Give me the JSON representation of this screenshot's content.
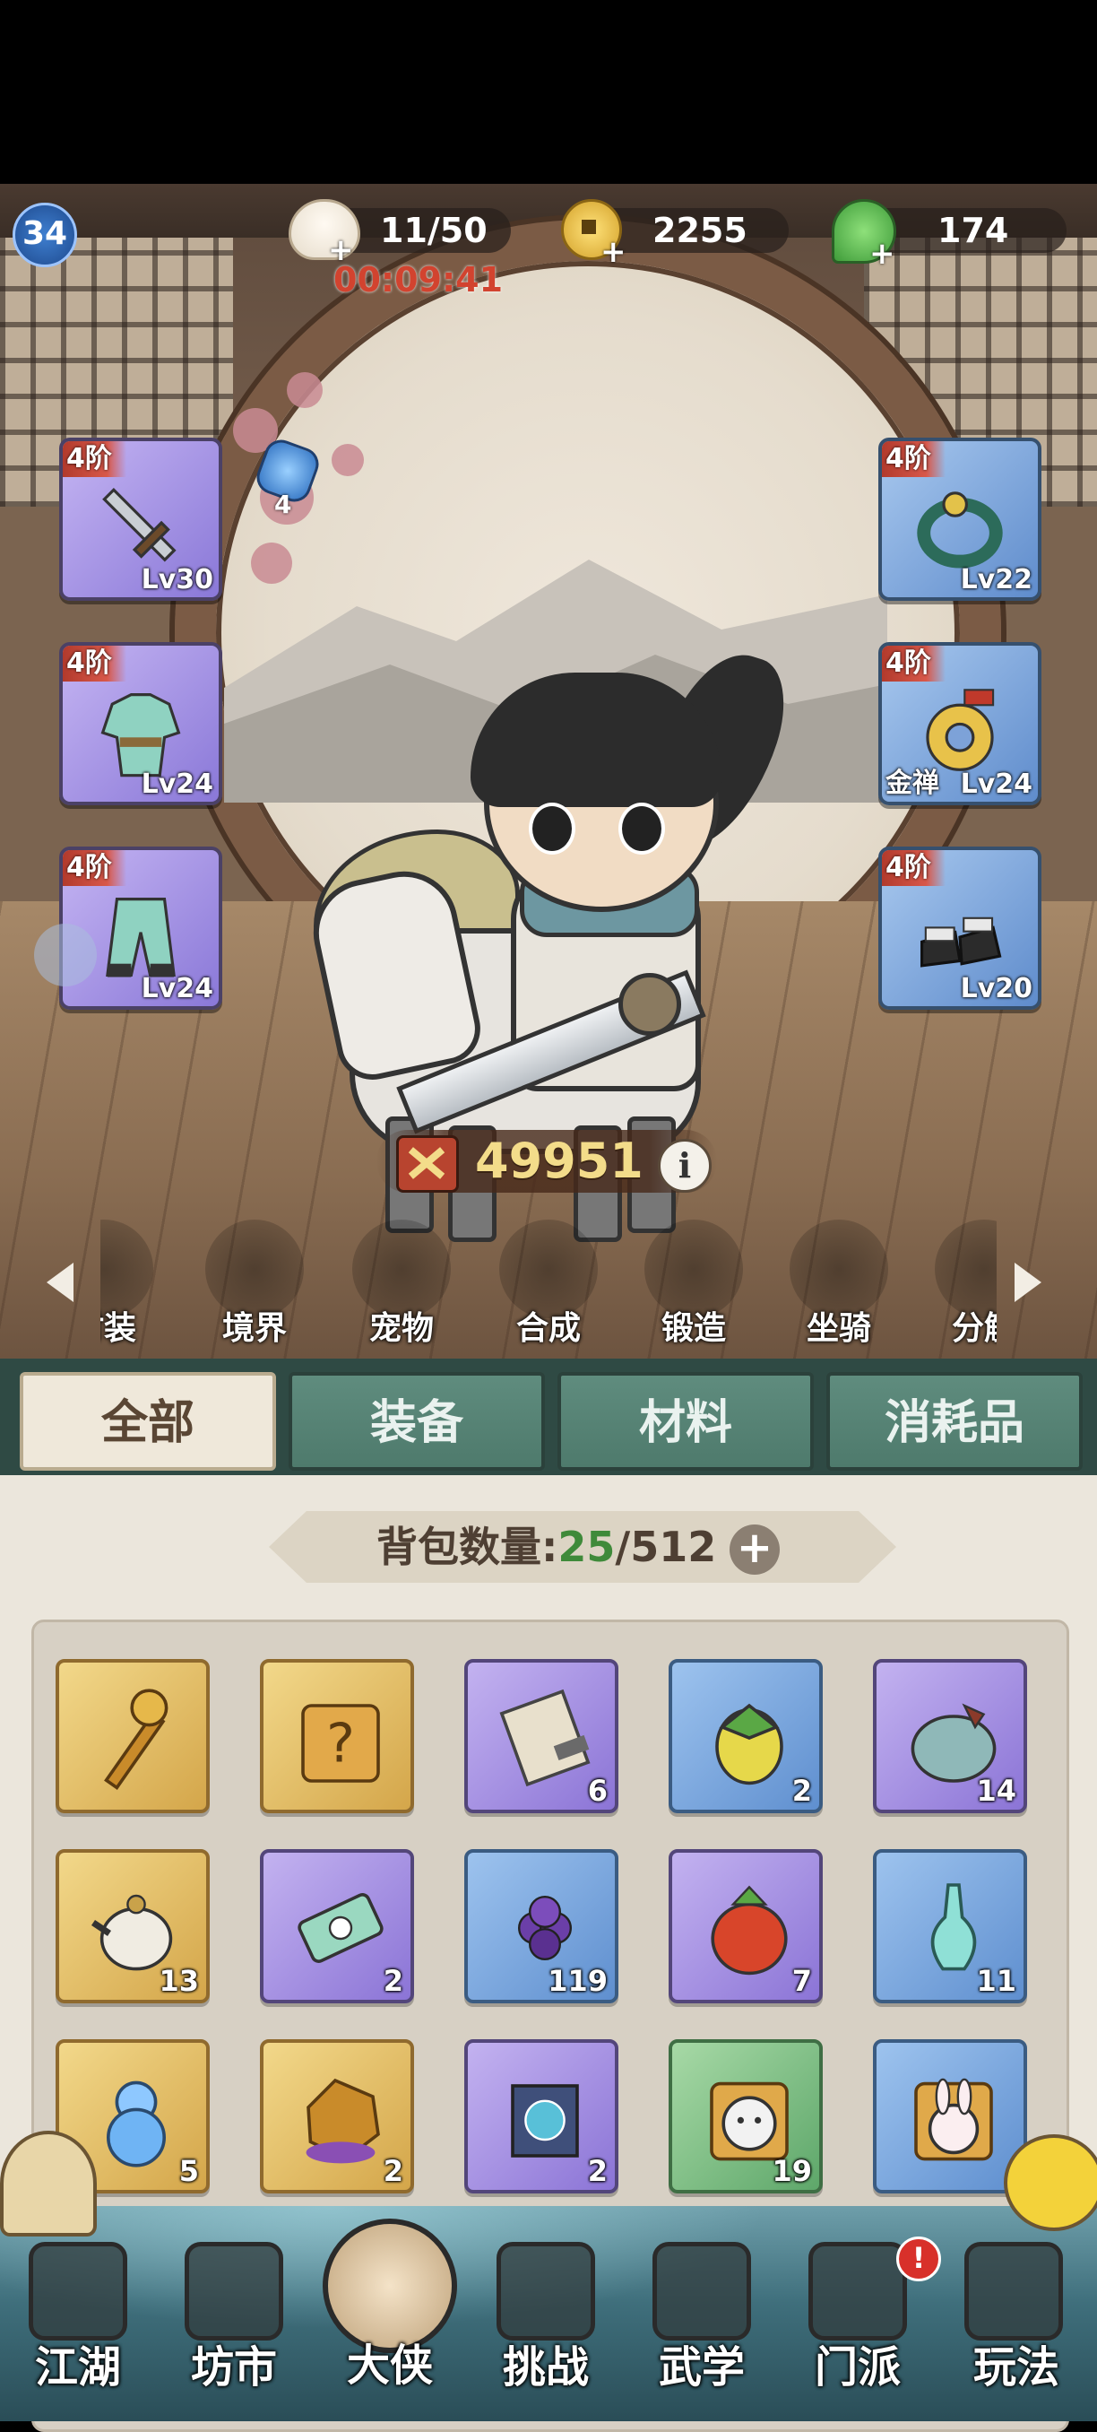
{
  "status": {
    "level": "34",
    "stamina": "11/50",
    "stamina_timer": "00:09:41",
    "coins": "2255",
    "leaves": "174"
  },
  "equipment": {
    "left": [
      {
        "tier": "4阶",
        "level": "Lv30",
        "icon": "sword-icon"
      },
      {
        "tier": "4阶",
        "level": "Lv24",
        "icon": "robe-icon"
      },
      {
        "tier": "4阶",
        "level": "Lv24",
        "icon": "pants-icon"
      }
    ],
    "right": [
      {
        "tier": "4阶",
        "level": "Lv22",
        "icon": "bracelet-icon"
      },
      {
        "tier": "4阶",
        "name": "金禅",
        "level": "Lv24",
        "icon": "jade-ring-icon"
      },
      {
        "tier": "4阶",
        "level": "Lv20",
        "icon": "boots-icon"
      }
    ],
    "gem_count": "4"
  },
  "combat_power": "49951",
  "functions": [
    {
      "label": "时装",
      "icon": "costume-icon"
    },
    {
      "label": "境界",
      "icon": "realm-icon"
    },
    {
      "label": "宠物",
      "icon": "pet-icon"
    },
    {
      "label": "合成",
      "icon": "synthesis-icon"
    },
    {
      "label": "锻造",
      "icon": "forge-icon"
    },
    {
      "label": "坐骑",
      "icon": "mount-icon"
    },
    {
      "label": "分解",
      "icon": "decompose-icon"
    }
  ],
  "bag": {
    "tabs": [
      "全部",
      "装备",
      "材料",
      "消耗品"
    ],
    "active_tab": 0,
    "count_label": "背包数量:",
    "count_used": "25",
    "count_total": "/512",
    "items": [
      {
        "quality": "gold",
        "count": "",
        "icon": "golden-staff-icon"
      },
      {
        "quality": "gold",
        "count": "",
        "icon": "mystery-puzzle-icon"
      },
      {
        "quality": "purple",
        "count": "6",
        "icon": "scroll-icon"
      },
      {
        "quality": "blue",
        "count": "2",
        "icon": "fruit-icon"
      },
      {
        "quality": "purple",
        "count": "14",
        "icon": "pouch-icon"
      },
      {
        "quality": "gold",
        "count": "13",
        "icon": "teapot-icon"
      },
      {
        "quality": "purple",
        "count": "2",
        "icon": "ticket-icon"
      },
      {
        "quality": "blue",
        "count": "119",
        "icon": "berry-icon"
      },
      {
        "quality": "purple",
        "count": "7",
        "icon": "bag-icon"
      },
      {
        "quality": "blue",
        "count": "11",
        "icon": "vase-icon"
      },
      {
        "quality": "gold",
        "count": "5",
        "icon": "gourd-icon"
      },
      {
        "quality": "gold",
        "count": "2",
        "icon": "ore-icon"
      },
      {
        "quality": "purple",
        "count": "2",
        "icon": "book-icon"
      },
      {
        "quality": "green",
        "count": "19",
        "icon": "tiger-puzzle-icon"
      },
      {
        "quality": "blue",
        "count": "",
        "icon": "rabbit-puzzle-icon"
      }
    ]
  },
  "nav": [
    {
      "label": "江湖",
      "icon": "jianghu-icon"
    },
    {
      "label": "坊市",
      "icon": "market-icon"
    },
    {
      "label": "大侠",
      "icon": "hero-icon"
    },
    {
      "label": "挑战",
      "icon": "challenge-icon"
    },
    {
      "label": "武学",
      "icon": "martial-arts-icon"
    },
    {
      "label": "门派",
      "icon": "sect-icon"
    },
    {
      "label": "玩法",
      "icon": "gameplay-icon"
    }
  ],
  "colors": {
    "accent_green": "#3f8a3a",
    "power_gold": "#f3dc8a",
    "timer_red": "#d2432f"
  }
}
